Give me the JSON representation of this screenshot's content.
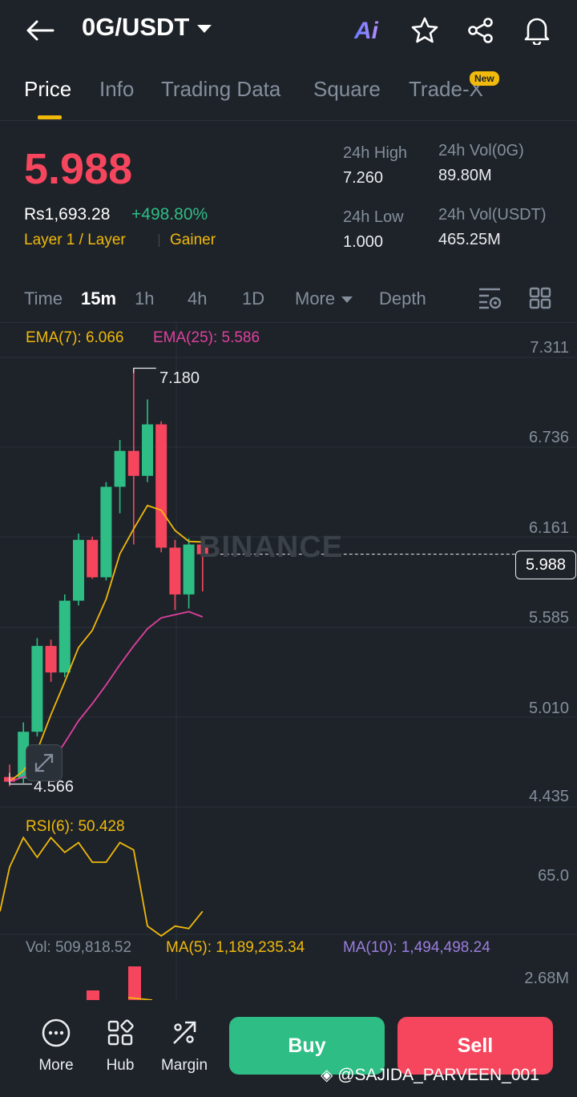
{
  "header": {
    "pair": "0G/USDT",
    "ai_label": "Ai",
    "icons": [
      "back-arrow-icon",
      "star-icon",
      "share-icon",
      "bell-icon"
    ]
  },
  "tabs": [
    {
      "label": "Price",
      "active": true
    },
    {
      "label": "Info"
    },
    {
      "label": "Trading Data"
    },
    {
      "label": "Square"
    },
    {
      "label": "Trade-X",
      "badge": "New"
    }
  ],
  "ticker": {
    "price": "5.988",
    "fiat": "Rs1,693.28",
    "change": "+498.80%",
    "tag1": "Layer 1 / Layer",
    "tag2": "Gainer",
    "high_label": "24h High",
    "high": "7.260",
    "low_label": "24h Low",
    "low": "1.000",
    "vol_base_label": "24h Vol(0G)",
    "vol_base": "89.80M",
    "vol_quote_label": "24h Vol(USDT)",
    "vol_quote": "465.25M"
  },
  "intervals": {
    "items": [
      "Time",
      "15m",
      "1h",
      "4h",
      "1D",
      "More",
      "Depth"
    ],
    "active": "15m"
  },
  "chart": {
    "ema7": "EMA(7): 6.066",
    "ema25": "EMA(25): 5.586",
    "price_axis": [
      "7.311",
      "6.736",
      "6.161",
      "5.585",
      "5.010",
      "4.435"
    ],
    "current_price_tag": "5.988",
    "high_marker": "7.180",
    "low_marker": "4.566",
    "watermark": "BINANCE",
    "rsi_label": "RSI(6): 50.428",
    "rsi_axis": "65.0",
    "vol_label": "Vol: 509,818.52",
    "ma5_label": "MA(5): 1,189,235.34",
    "ma10_label": "MA(10): 1,494,498.24",
    "vol_axis": "2.68M",
    "colors": {
      "up": "#2ebd85",
      "down": "#f6465d",
      "ema7": "#f0b90b",
      "ema25": "#e040a0",
      "ma10": "#9b7ee0"
    }
  },
  "chart_data": {
    "type": "candlestick",
    "ylim": [
      4.435,
      7.311
    ],
    "candles": [
      {
        "o": 4.56,
        "h": 4.64,
        "l": 4.5,
        "c": 4.53
      },
      {
        "o": 4.55,
        "h": 4.91,
        "l": 4.52,
        "c": 4.85
      },
      {
        "o": 4.85,
        "h": 5.45,
        "l": 4.82,
        "c": 5.4
      },
      {
        "o": 5.4,
        "h": 5.44,
        "l": 5.17,
        "c": 5.23
      },
      {
        "o": 5.23,
        "h": 5.73,
        "l": 5.2,
        "c": 5.69
      },
      {
        "o": 5.69,
        "h": 6.12,
        "l": 5.66,
        "c": 6.08
      },
      {
        "o": 6.08,
        "h": 6.1,
        "l": 5.83,
        "c": 5.84
      },
      {
        "o": 5.84,
        "h": 6.45,
        "l": 5.82,
        "c": 6.42
      },
      {
        "o": 6.42,
        "h": 6.72,
        "l": 6.25,
        "c": 6.65
      },
      {
        "o": 6.65,
        "h": 7.18,
        "l": 6.05,
        "c": 6.49
      },
      {
        "o": 6.49,
        "h": 6.98,
        "l": 6.45,
        "c": 6.82
      },
      {
        "o": 6.82,
        "h": 6.84,
        "l": 6.0,
        "c": 6.03
      },
      {
        "o": 6.03,
        "h": 6.08,
        "l": 5.63,
        "c": 5.73
      },
      {
        "o": 5.73,
        "h": 6.09,
        "l": 5.64,
        "c": 6.05
      },
      {
        "o": 6.05,
        "h": 6.07,
        "l": 5.75,
        "c": 5.988
      }
    ],
    "ema7": [
      4.53,
      4.6,
      4.73,
      4.96,
      5.17,
      5.39,
      5.5,
      5.7,
      5.99,
      6.15,
      6.3,
      6.27,
      6.14,
      6.07,
      6.066
    ],
    "ema25": [
      4.53,
      4.56,
      4.59,
      4.65,
      4.78,
      4.92,
      5.03,
      5.15,
      5.28,
      5.4,
      5.51,
      5.58,
      5.6,
      5.62,
      5.586
    ],
    "rsi": [
      68,
      80,
      72,
      80,
      74,
      78,
      70,
      70,
      78,
      75,
      44,
      40,
      44,
      43,
      50
    ]
  },
  "bottom": {
    "nav": [
      {
        "label": "More",
        "icon": "more-dots-icon"
      },
      {
        "label": "Hub",
        "icon": "hub-grid-icon"
      },
      {
        "label": "Margin",
        "icon": "margin-icon"
      }
    ],
    "buy": "Buy",
    "sell": "Sell",
    "credit": "@SAJIDA_PARVEEN_001"
  }
}
